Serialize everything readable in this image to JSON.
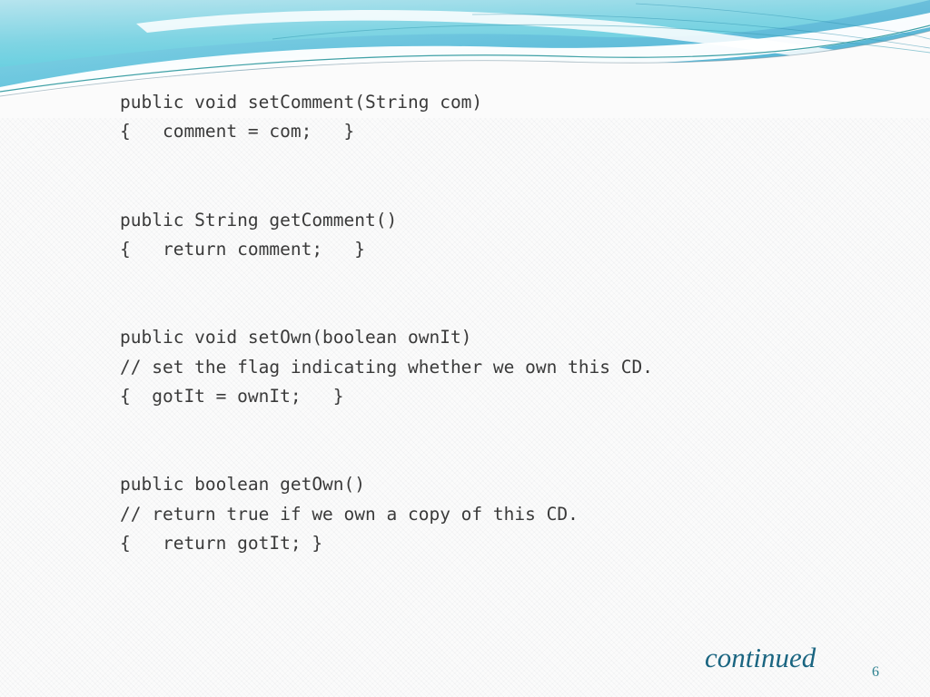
{
  "slide": {
    "page_number": "6",
    "continued_label": "continued",
    "colors": {
      "background": "#fbfbfb",
      "code_text": "#3a3a3a",
      "accent_teal": "#1a6581",
      "page_number": "#2a7f8e",
      "swoosh_cyan_light": "#a8e0ea",
      "swoosh_cyan": "#62cfe0",
      "swoosh_blue": "#6fb9d8",
      "swoosh_line_teal": "#1f8f92"
    }
  },
  "code_blocks": [
    {
      "name": "set-comment",
      "lines": [
        "public void setComment(String com)",
        "{   comment = com;   }"
      ]
    },
    {
      "name": "get-comment",
      "lines": [
        "public String getComment()",
        "{   return comment;   }"
      ]
    },
    {
      "name": "set-own",
      "lines": [
        "public void setOwn(boolean ownIt)",
        "// set the flag indicating whether we own this CD.",
        "{  gotIt = ownIt;   }"
      ]
    },
    {
      "name": "get-own",
      "lines": [
        "public boolean getOwn()",
        "// return true if we own a copy of this CD.",
        "{   return gotIt; }"
      ]
    }
  ]
}
